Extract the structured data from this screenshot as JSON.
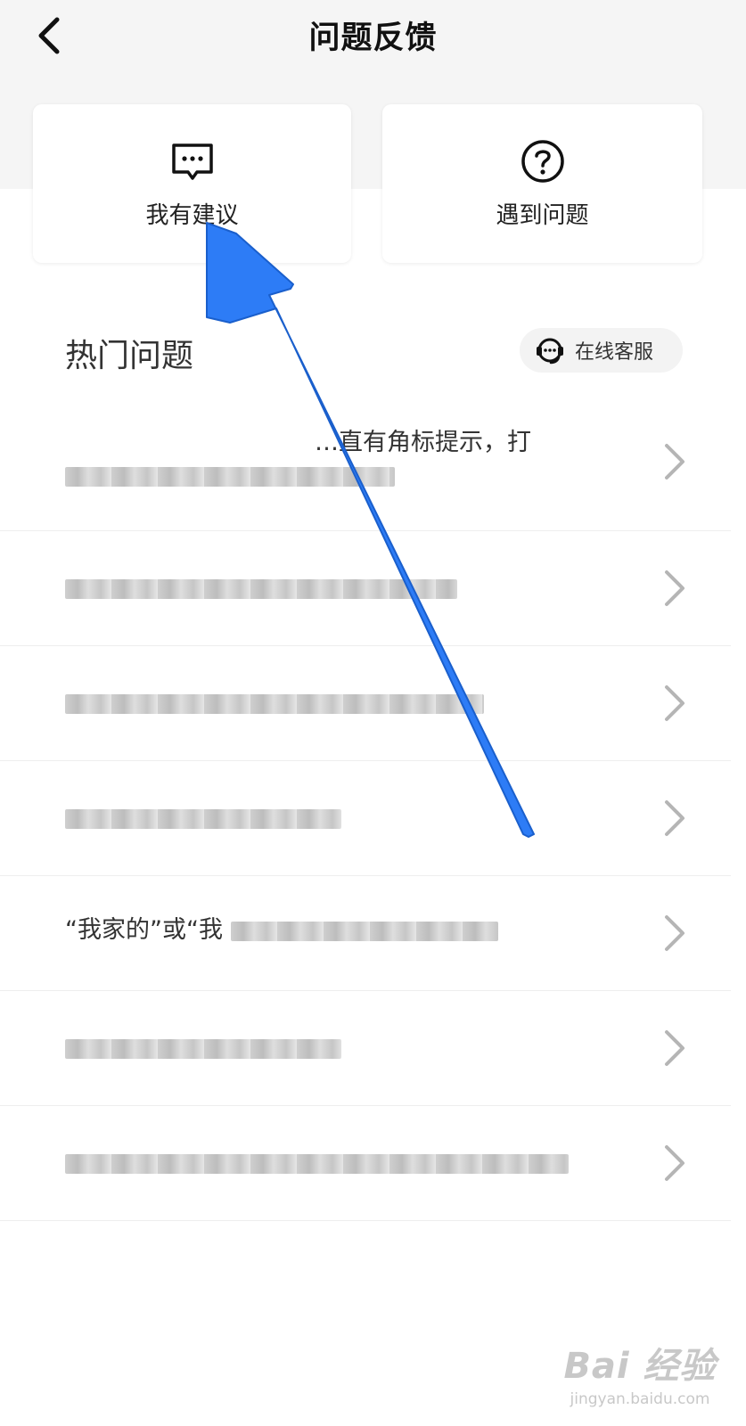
{
  "header": {
    "title": "问题反馈",
    "back_icon": "chevron-left-icon"
  },
  "cards": [
    {
      "label": "我有建议",
      "icon": "message-dots-icon"
    },
    {
      "label": "遇到问题",
      "icon": "question-circle-icon"
    }
  ],
  "hot": {
    "title": "热门问题",
    "customer_service": {
      "label": "在线客服",
      "icon": "headset-icon"
    }
  },
  "faq": [
    {
      "text": "…直有角标提示，打"
    },
    {
      "text": ""
    },
    {
      "text": ""
    },
    {
      "text": ""
    },
    {
      "text": "“我家的”或“我"
    },
    {
      "text": ""
    },
    {
      "text": ""
    }
  ],
  "annotation": {
    "color": "#2d7cf6",
    "shape": "arrow"
  },
  "watermark": {
    "logo": "Bai 经验",
    "url": "jingyan.baidu.com"
  }
}
